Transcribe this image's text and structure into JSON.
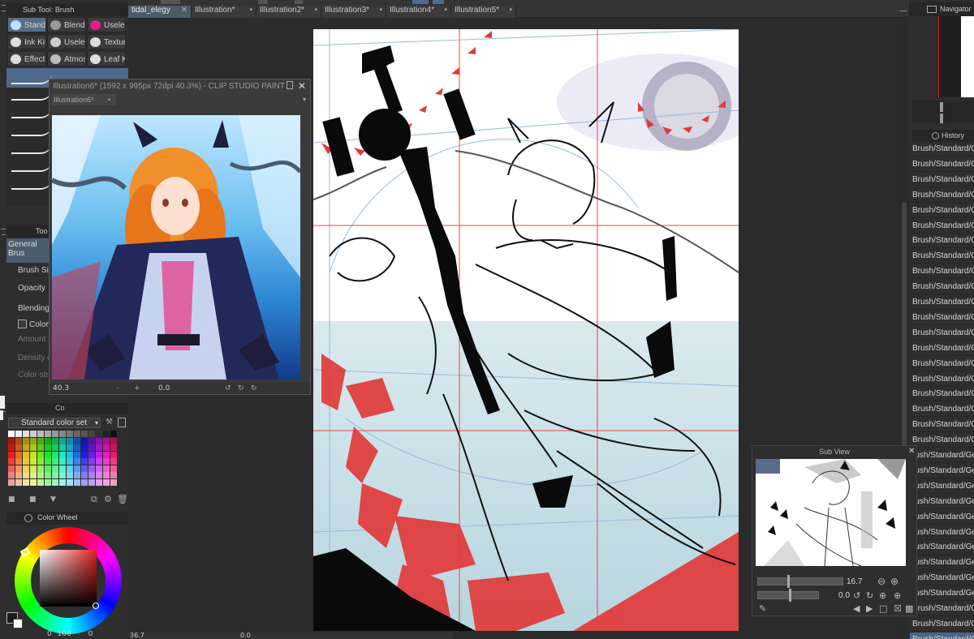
{
  "doc_tabs": [
    {
      "label": "tidal_elegy",
      "active": true
    },
    {
      "label": "Illustration*",
      "active": false
    },
    {
      "label": "Illustration2*",
      "active": false
    },
    {
      "label": "Illustration3*",
      "active": false
    },
    {
      "label": "Illustration4*",
      "active": false
    },
    {
      "label": "Illustration5*",
      "active": false
    }
  ],
  "subtool": {
    "title": "Sub Tool: Brush",
    "buttons": [
      {
        "label": "Stand",
        "selected": true
      },
      {
        "label": "Blend",
        "selected": false
      },
      {
        "label": "Useles",
        "selected": false
      },
      {
        "label": "Ink Kit",
        "selected": false
      },
      {
        "label": "Useles",
        "selected": false
      },
      {
        "label": "Textur",
        "selected": false
      },
      {
        "label": "Effects",
        "selected": false
      },
      {
        "label": "Atmos",
        "selected": false
      },
      {
        "label": "Leaf K",
        "selected": false
      }
    ]
  },
  "tool_property": {
    "title": "Too",
    "preset": "General Brus",
    "props": [
      {
        "label": "Brush Siz",
        "enabled": true
      },
      {
        "label": "Opacity",
        "enabled": true
      },
      {
        "label": "Blending",
        "enabled": true
      },
      {
        "label": "Color",
        "enabled": true
      },
      {
        "label": "Amount o",
        "enabled": false
      },
      {
        "label": "Density o",
        "enabled": false
      },
      {
        "label": "Color stre",
        "enabled": false
      }
    ]
  },
  "color_set": {
    "tab": "Co",
    "selected_set": "Standard color set"
  },
  "color_wheel": {
    "title": "Color Wheel",
    "bottom_values": [
      "0",
      "100",
      "0"
    ]
  },
  "reference_window": {
    "title": "Illustration6* (1592 x 995px 72dpi 40.3%) - CLIP STUDIO PAINT",
    "tab": "Illustration6*",
    "zoom": "40.3",
    "rotation": "0.0"
  },
  "navigator": {
    "title": "Navigator"
  },
  "history": {
    "title": "History",
    "entries": [
      "Brush/Standard/Ge",
      "Brush/Standard/Ge",
      "Brush/Standard/Ge",
      "Brush/Standard/Ge",
      "Brush/Standard/Ge",
      "Brush/Standard/Ge",
      "Brush/Standard/Ge",
      "Brush/Standard/Ge",
      "Brush/Standard/Ge",
      "Brush/Standard/Ge",
      "Brush/Standard/Ge",
      "Brush/Standard/Ge",
      "Brush/Standard/Ge",
      "Brush/Standard/Ge",
      "Brush/Standard/Ge",
      "Brush/Standard/Ge",
      "Brush/Standard/Ge",
      "Brush/Standard/Ge",
      "Brush/Standard/Ge",
      "Brush/Standard/Ge",
      "rush/Standard/Ge",
      "rush/Standard/Ge",
      "rush/Standard/Ge",
      "rush/Standard/Ge",
      "rush/Standard/Ge",
      "rush/Standard/Ge",
      "rush/Standard/Ge",
      "rush/Standard/Ge",
      "rush/Standard/Ge",
      "rush/Standard/Ge",
      "Brush/Standard/Ge",
      "Brush/Standard/Ge",
      "Brush/Standard/Ge"
    ],
    "selected_index": 32
  },
  "sub_view": {
    "title": "Sub View",
    "zoom": "16.7",
    "rotation": "0.0"
  },
  "bottom_status": {
    "zoom": "36.7",
    "rotation": "0.0"
  },
  "colors": {
    "accent": "#4a6586",
    "panel": "#2e2e2e",
    "canvas_red": "#e23a3a",
    "guide_blue": "#8fb4e0"
  }
}
